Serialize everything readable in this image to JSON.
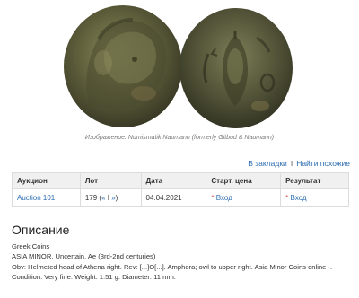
{
  "image_caption": "Изображение: Numismatik Naumann (formerly Gitbud & Naumann)",
  "actions": {
    "bookmarks": "В закладки",
    "separator": "I",
    "find_similar": "Найти похожие"
  },
  "table": {
    "headers": [
      "Аукцион",
      "Лот",
      "Дата",
      "Старт. цена",
      "Результат"
    ],
    "row": {
      "auction": "Auction 101",
      "lot_number": "179",
      "lot_nav_prev": "«",
      "lot_nav_mid": "I",
      "lot_nav_next": "»",
      "date": "04.04.2021",
      "start_price_star": "*",
      "start_price": "Вход",
      "result_star": "*",
      "result": "Вход"
    }
  },
  "description": {
    "heading": "Описание",
    "lines": [
      "Greek Coins",
      "ASIA MINOR. Uncertain. Ae (3rd-2nd centuries)",
      "Obv: Helmeted head of Athena right. Rev: [...]O[...]. Amphora; owl to upper right. Asia Minor Coins online -. Condition: Very fine. Weight: 1.51 g. Diameter: 11 mm."
    ]
  },
  "colors": {
    "link": "#2b6cb0",
    "star": "#d9534f",
    "coin_bronze": "#6b6a45"
  },
  "icons": {
    "obverse": "coin-obverse-athena-image",
    "reverse": "coin-reverse-amphora-image"
  }
}
